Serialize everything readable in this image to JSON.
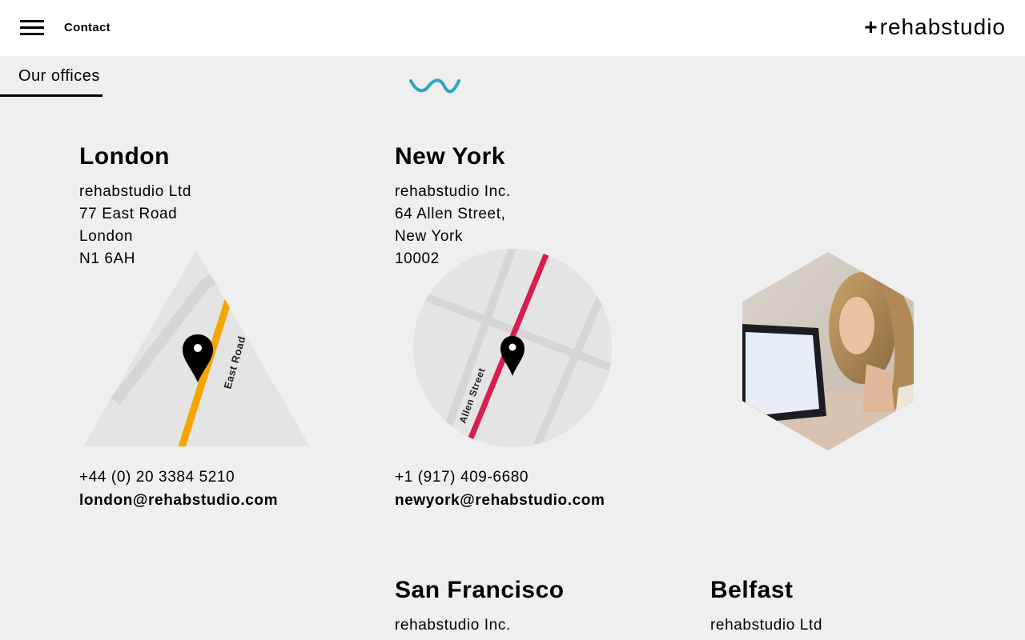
{
  "header": {
    "contact_label": "Contact",
    "logo_plus": "+",
    "logo_text": "rehabstudio"
  },
  "section": {
    "tab_label": "Our offices"
  },
  "colors": {
    "wave": "#2aa6c0",
    "london_road": "#f5a500",
    "newyork_street": "#d81e4d",
    "map_bg": "#e4e4e4"
  },
  "offices": [
    {
      "city": "London",
      "address": [
        "rehabstudio Ltd",
        "77 East Road",
        "London",
        "N1 6AH"
      ],
      "map_label": "East Road",
      "phone": "+44 (0) 20 3384 5210",
      "email": "london@rehabstudio.com"
    },
    {
      "city": "New York",
      "address": [
        "rehabstudio Inc.",
        "64 Allen Street,",
        "New York",
        "10002"
      ],
      "map_label": "Allen Street",
      "phone": "+1 (917) 409-6680",
      "email": "newyork@rehabstudio.com"
    },
    {
      "city": "San Francisco",
      "address": [
        "rehabstudio Inc."
      ]
    },
    {
      "city": "Belfast",
      "address": [
        "rehabstudio Ltd"
      ]
    }
  ]
}
